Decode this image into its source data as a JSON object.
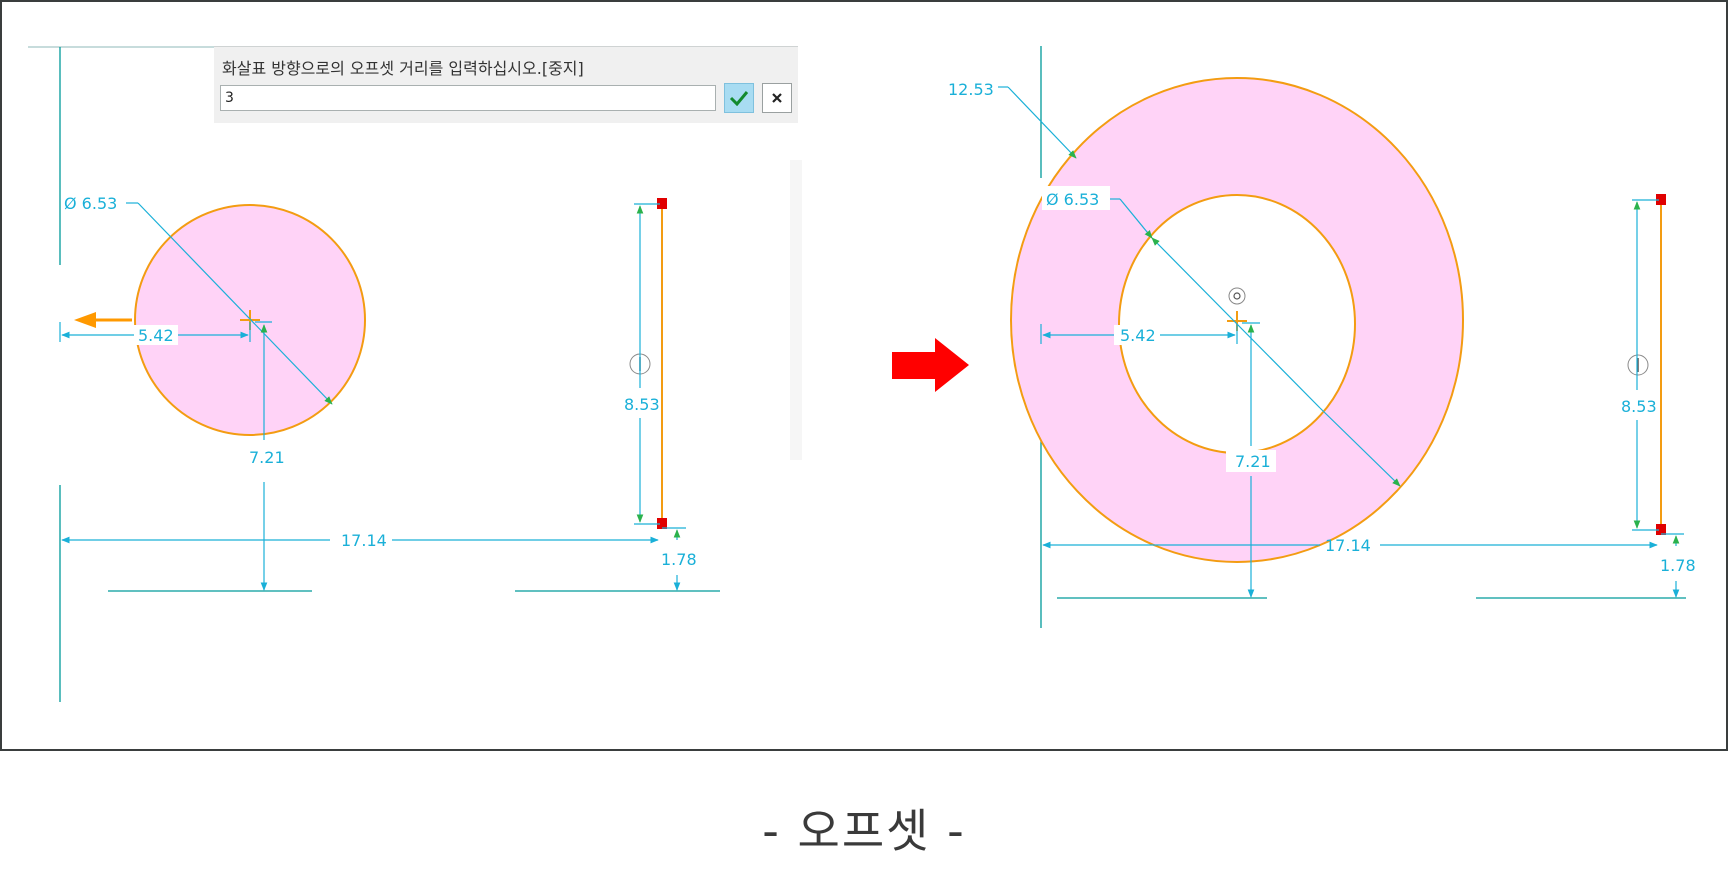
{
  "prompt": {
    "message": "화살표 방향으로의 오프셋 거리를 입력하십시오.[중지]",
    "input_value": "3",
    "ok_icon": "checkmark-icon",
    "cancel_icon": "close-icon"
  },
  "before": {
    "diameter_label": "Ø 6.53",
    "horizontal_label": "5.42",
    "vertical_label": "7.21",
    "line_length_label": "8.53",
    "width_label": "17.14",
    "line_offset_label": "1.78"
  },
  "after": {
    "outer_diameter_label": "12.53",
    "diameter_label": "Ø 6.53",
    "horizontal_label": "5.42",
    "vertical_label": "7.21",
    "line_length_label": "8.53",
    "width_label": "17.14",
    "line_offset_label": "1.78"
  },
  "caption": "- 오프셋  -",
  "colors": {
    "dimension": "#1ab0d8",
    "geometry": "#f39c12",
    "fill": "#ffd3f7",
    "arrow": "#ff0000",
    "endpoint": "#e00000",
    "dim_arrowhead": "#2bb24c",
    "offset_arrow": "#ff9900"
  },
  "icons": {
    "direction_arrow": "right-arrow-icon",
    "offset_direction": "left-arrow-icon",
    "center_marker": "center-point-icon",
    "vertical_constraint": "vertical-constraint-icon"
  }
}
